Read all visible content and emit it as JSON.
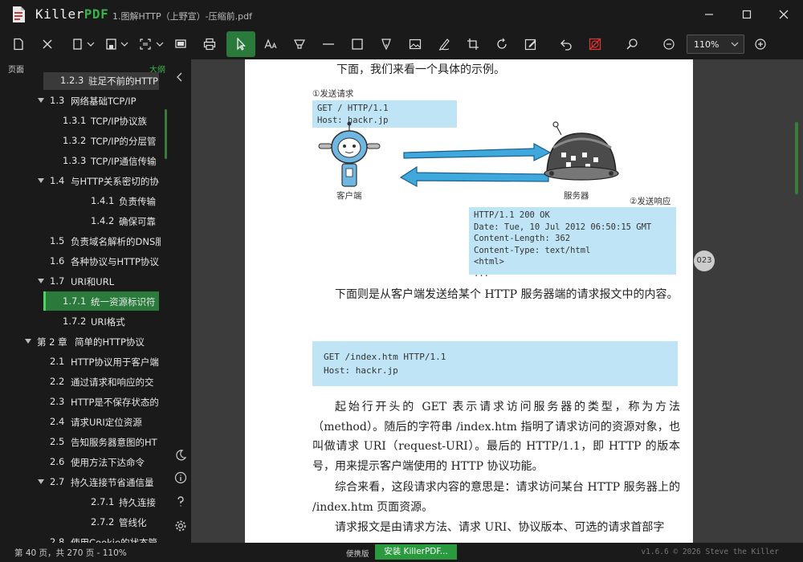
{
  "window": {
    "brand_part1": "Killer",
    "brand_part2": "PDF",
    "doc_title": "1.图解HTTP（上野宣）-压缩前.pdf"
  },
  "toolbar": {
    "zoom_value": "110%"
  },
  "sidebar": {
    "tab_pages": "页面",
    "tab_outline": "大纲",
    "outline": [
      {
        "num": "1.2.3",
        "label": "驻足不前的HTTP",
        "level": 3,
        "state": "hover"
      },
      {
        "num": "1.3",
        "label": "网络基础TCP/IP",
        "level": 2,
        "expanded": true
      },
      {
        "num": "1.3.1",
        "label": "TCP/IP协议族",
        "level": 3
      },
      {
        "num": "1.3.2",
        "label": "TCP/IP的分层管",
        "level": 3
      },
      {
        "num": "1.3.3",
        "label": "TCP/IP通信传输",
        "level": 3
      },
      {
        "num": "1.4",
        "label": "与HTTP关系密切的协",
        "level": 2,
        "expanded": true
      },
      {
        "num": "1.4.1",
        "label": "负责传输",
        "level": 4
      },
      {
        "num": "1.4.2",
        "label": "确保可靠",
        "level": 4
      },
      {
        "num": "1.5",
        "label": "负责域名解析的DNS服",
        "level": 2
      },
      {
        "num": "1.6",
        "label": "各种协议与HTTP协议",
        "level": 2
      },
      {
        "num": "1.7",
        "label": "URI和URL",
        "level": 2,
        "expanded": true
      },
      {
        "num": "1.7.1",
        "label": "统一资源标识符",
        "level": 3,
        "state": "selected"
      },
      {
        "num": "1.7.2",
        "label": "URI格式",
        "level": 3
      },
      {
        "num": "第 2 章",
        "label": "简单的HTTP协议",
        "level": 1,
        "expanded": true
      },
      {
        "num": "2.1",
        "label": "HTTP协议用于客户端",
        "level": 2
      },
      {
        "num": "2.2",
        "label": "通过请求和响应的交",
        "level": 2
      },
      {
        "num": "2.3",
        "label": "HTTP是不保存状态的",
        "level": 2
      },
      {
        "num": "2.4",
        "label": "请求URI定位资源",
        "level": 2
      },
      {
        "num": "2.5",
        "label": "告知服务器意图的HT",
        "level": 2
      },
      {
        "num": "2.6",
        "label": "使用方法下达命令",
        "level": 2
      },
      {
        "num": "2.7",
        "label": "持久连接节省通信量",
        "level": 2,
        "expanded": true
      },
      {
        "num": "2.7.1",
        "label": "持久连接",
        "level": 4
      },
      {
        "num": "2.7.2",
        "label": "管线化",
        "level": 4
      },
      {
        "num": "2.8",
        "label": "使用Cookie的状态管",
        "level": 2
      }
    ]
  },
  "page": {
    "intro": "下面，我们来看一个具体的示例。",
    "step1_label": "①发送请求",
    "request_lines": [
      "GET / HTTP/1.1",
      "Host: hackr.jp"
    ],
    "client_label": "客户端",
    "server_label": "服务器",
    "step2_label": "②发送响应",
    "response_lines": [
      "HTTP/1.1 200 OK",
      "Date: Tue, 10 Jul 2012 06:50:15 GMT",
      "Content-Length: 362",
      "Content-Type: text/html",
      "<html>",
      "..."
    ],
    "page_number": "023",
    "para1": "下面则是从客户端发送给某个 HTTP 服务器端的请求报文中的内容。",
    "code2_lines": [
      "GET /index.htm HTTP/1.1",
      "Host: hackr.jp"
    ],
    "para2": "起始行开头的 GET 表示请求访问服务器的类型，称为方法（method）。随后的字符串 /index.htm 指明了请求访问的资源对象，也叫做请求 URI（request-URI）。最后的 HTTP/1.1，即 HTTP 的版本号，用来提示客户端使用的 HTTP 协议功能。",
    "para3": "综合来看，这段请求内容的意思是：请求访问某台 HTTP 服务器上的 /index.htm 页面资源。",
    "para4": "请求报文是由请求方法、请求 URI、协议版本、可选的请求首部字"
  },
  "status": {
    "page_info": "第 40 页，共 270 页 - 110%",
    "trial_label": "便携版",
    "install_label": "安装 KillerPDF...",
    "version": "v1.6.6 © 2026  Steve the Killer"
  },
  "colors": {
    "accent_green": "#2a7a3b",
    "code_bg": "#bfe4f5"
  }
}
